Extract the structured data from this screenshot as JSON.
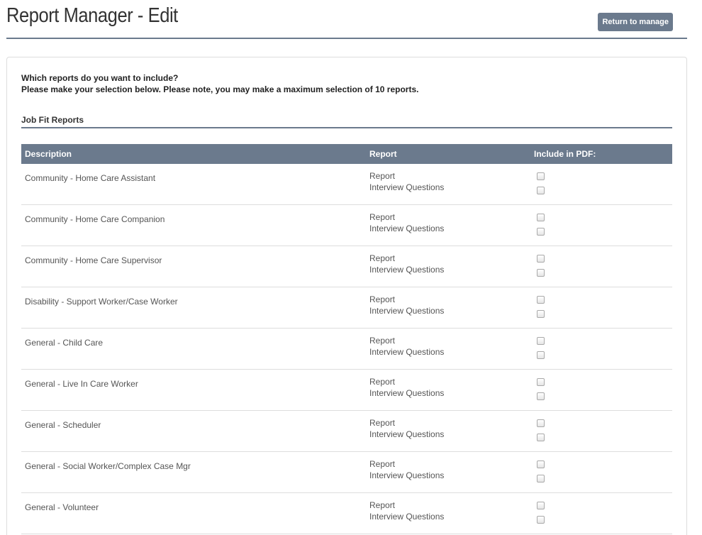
{
  "header": {
    "title": "Report Manager - Edit",
    "return_label": "Return to manage"
  },
  "intro": {
    "line1": "Which reports do you want to include?",
    "line2": "Please make your selection below. Please note, you may make a maximum selection of 10 reports."
  },
  "section": {
    "title": "Job Fit Reports"
  },
  "table": {
    "columns": [
      "Description",
      "Report",
      "Include in PDF:"
    ],
    "rows": [
      {
        "description": "Community - Home Care Assistant",
        "report": "Report",
        "interview": "Interview Questions",
        "report_checked": false,
        "interview_checked": false
      },
      {
        "description": "Community - Home Care Companion",
        "report": "Report",
        "interview": "Interview Questions",
        "report_checked": false,
        "interview_checked": false
      },
      {
        "description": "Community - Home Care Supervisor",
        "report": "Report",
        "interview": "Interview Questions",
        "report_checked": false,
        "interview_checked": false
      },
      {
        "description": "Disability - Support Worker/Case Worker",
        "report": "Report",
        "interview": "Interview Questions",
        "report_checked": false,
        "interview_checked": false
      },
      {
        "description": "General - Child Care",
        "report": "Report",
        "interview": "Interview Questions",
        "report_checked": false,
        "interview_checked": false
      },
      {
        "description": "General - Live In Care Worker",
        "report": "Report",
        "interview": "Interview Questions",
        "report_checked": false,
        "interview_checked": false
      },
      {
        "description": "General - Scheduler",
        "report": "Report",
        "interview": "Interview Questions",
        "report_checked": false,
        "interview_checked": false
      },
      {
        "description": "General - Social Worker/Complex Case Mgr",
        "report": "Report",
        "interview": "Interview Questions",
        "report_checked": false,
        "interview_checked": false
      },
      {
        "description": "General - Volunteer",
        "report": "Report",
        "interview": "Interview Questions",
        "report_checked": false,
        "interview_checked": false
      }
    ]
  },
  "colors": {
    "accent": "#6b7a8d"
  }
}
